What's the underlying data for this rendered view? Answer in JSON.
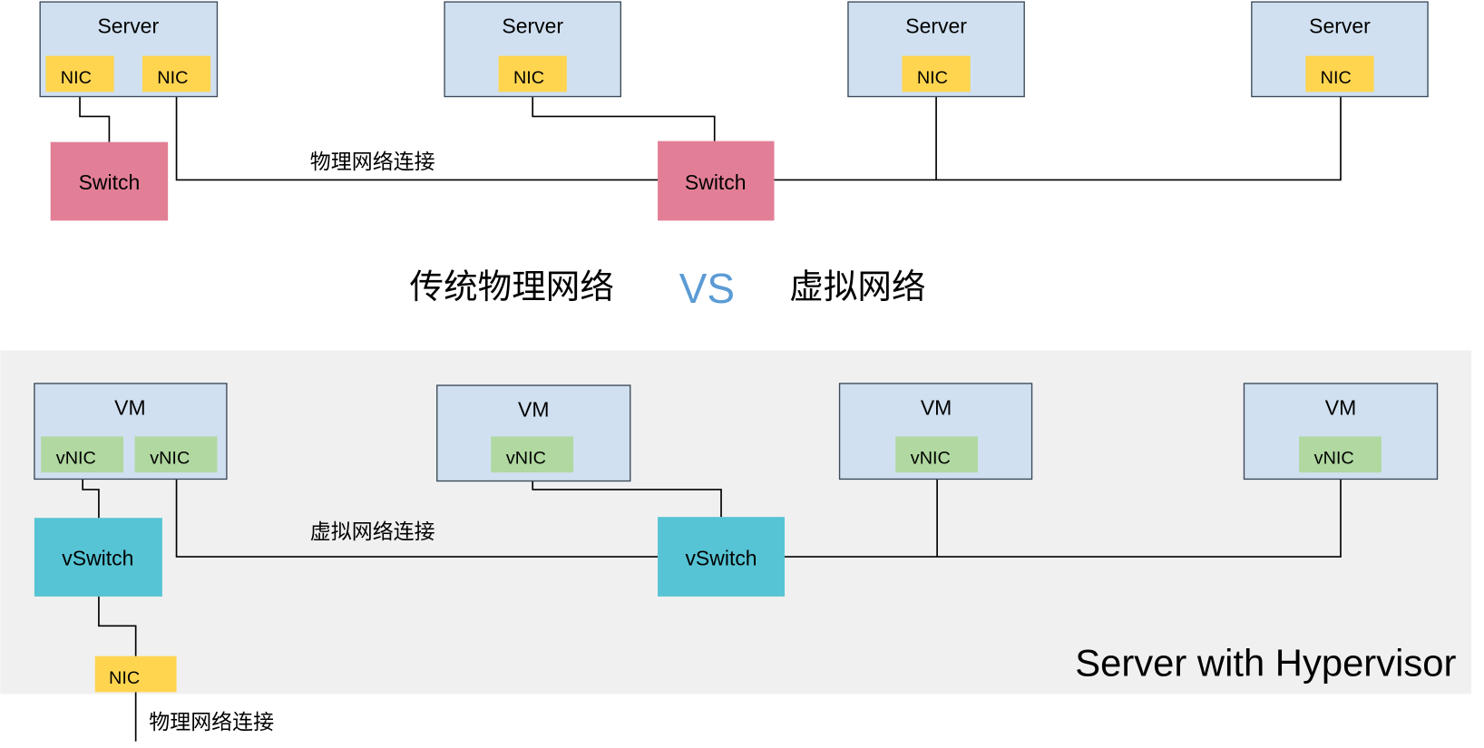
{
  "top": {
    "servers": [
      {
        "label": "Server",
        "nics": [
          "NIC",
          "NIC"
        ]
      },
      {
        "label": "Server",
        "nics": [
          "NIC"
        ]
      },
      {
        "label": "Server",
        "nics": [
          "NIC"
        ]
      },
      {
        "label": "Server",
        "nics": [
          "NIC"
        ]
      }
    ],
    "switches": [
      "Switch",
      "Switch"
    ],
    "link_label": "物理网络连接"
  },
  "titles": {
    "left": "传统物理网络",
    "vs": "VS",
    "right": "虚拟网络"
  },
  "bottom": {
    "vms": [
      {
        "label": "VM",
        "vnics": [
          "vNIC",
          "vNIC"
        ]
      },
      {
        "label": "VM",
        "vnics": [
          "vNIC"
        ]
      },
      {
        "label": "VM",
        "vnics": [
          "vNIC"
        ]
      },
      {
        "label": "VM",
        "vnics": [
          "vNIC"
        ]
      }
    ],
    "vswitches": [
      "vSwitch",
      "vSwitch"
    ],
    "link_label": "虚拟网络连接",
    "nic": "NIC",
    "physical_label": "物理网络连接",
    "host_label": "Server with Hypervisor"
  },
  "colors": {
    "server": "#d0e0f0",
    "nic": "#ffd54f",
    "vnic": "#b0d8a0",
    "switch": "#e27f96",
    "vswitch": "#56c4d4",
    "vs": "#5b9bd5",
    "hypervisor_bg": "#f0f0f0"
  }
}
